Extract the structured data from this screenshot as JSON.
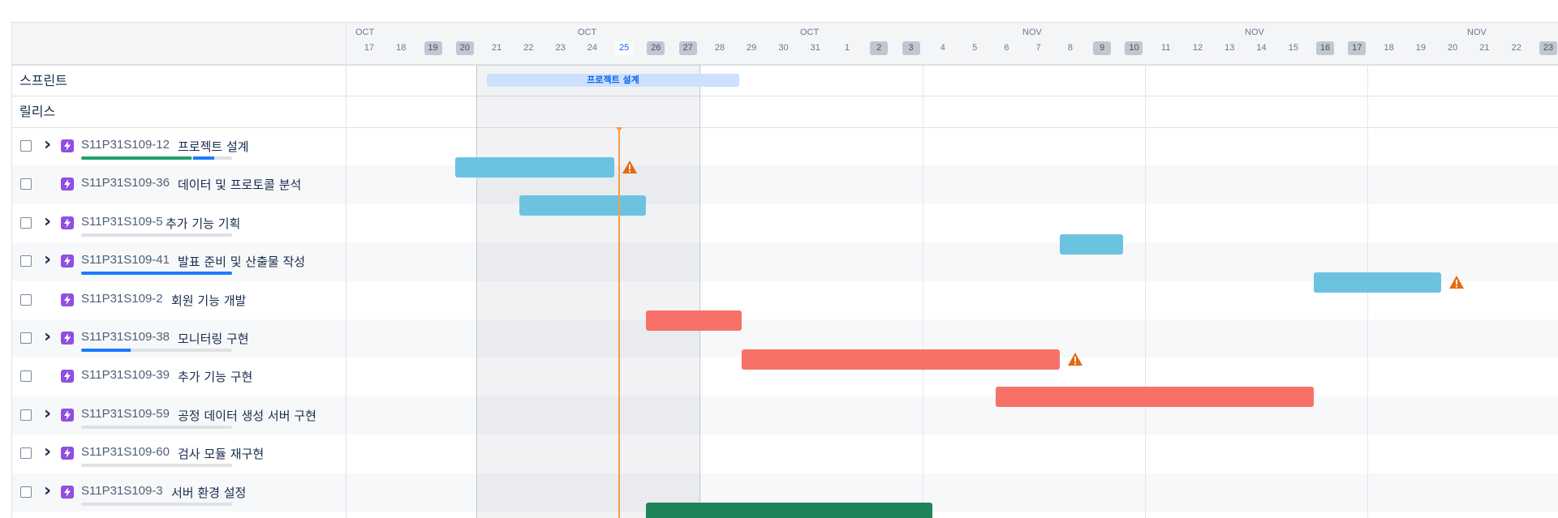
{
  "header": {
    "months": [
      "OCT",
      "OCT",
      "OCT",
      "NOV",
      "NOV",
      "NOV"
    ],
    "days": [
      "17",
      "18",
      "19",
      "20",
      "21",
      "22",
      "23",
      "24",
      "25",
      "26",
      "27",
      "28",
      "29",
      "30",
      "31",
      "1",
      "2",
      "3",
      "4",
      "5",
      "6",
      "7",
      "8",
      "9",
      "10",
      "11",
      "12",
      "13",
      "14",
      "15",
      "16",
      "17",
      "18",
      "19",
      "20",
      "21",
      "22",
      "23"
    ],
    "weekend_days": [
      "19",
      "20",
      "26",
      "27",
      "2",
      "3",
      "9",
      "10",
      "16",
      "17",
      "23"
    ],
    "today": "25"
  },
  "sections": {
    "sprint_label": "스프린트",
    "release_label": "릴리스",
    "sprint_pill": "프로젝트 설계"
  },
  "rows": [
    {
      "key": "S11P31S109-12",
      "title": "프로젝트 설계",
      "expandable": true,
      "progress": {
        "done": 0.73,
        "in_progress": 0.14
      },
      "bar_color": "blue",
      "warning": true
    },
    {
      "key": "S11P31S109-36",
      "title": "데이터 및 프로토콜 분석",
      "expandable": false,
      "progress": null,
      "bar_color": "blue",
      "warning": false
    },
    {
      "key": "S11P31S109-5",
      "title": "추가 기능 기획",
      "expandable": true,
      "progress": {
        "done": 0,
        "in_progress": 0
      },
      "bar_color": "blue",
      "warning": false
    },
    {
      "key": "S11P31S109-41",
      "title": "발표 준비 및 산출물 작성",
      "expandable": true,
      "progress": {
        "done": 0,
        "in_progress": 1.0
      },
      "bar_color": "blue",
      "warning": true
    },
    {
      "key": "S11P31S109-2",
      "title": "회원 기능 개발",
      "expandable": false,
      "progress": null,
      "bar_color": "red",
      "warning": false
    },
    {
      "key": "S11P31S109-38",
      "title": "모니터링 구현",
      "expandable": true,
      "progress": {
        "done": 0,
        "in_progress": 0.33
      },
      "bar_color": "red",
      "warning": true
    },
    {
      "key": "S11P31S109-39",
      "title": "추가 기능 구현",
      "expandable": false,
      "progress": null,
      "bar_color": "red",
      "warning": false
    },
    {
      "key": "S11P31S109-59",
      "title": "공정 데이터 생성 서버 구현",
      "expandable": true,
      "progress": {
        "done": 0,
        "in_progress": 0
      },
      "bar_color": null,
      "warning": false
    },
    {
      "key": "S11P31S109-60",
      "title": "검사 모듈 재구현",
      "expandable": true,
      "progress": {
        "done": 0,
        "in_progress": 0
      },
      "bar_color": null,
      "warning": false
    },
    {
      "key": "S11P31S109-3",
      "title": "서버 환경 설정",
      "expandable": true,
      "progress": {
        "done": 0,
        "in_progress": 0
      },
      "bar_color": "green",
      "warning": false
    }
  ],
  "colors": {
    "done": "#22a06b",
    "in_progress": "#1d7afc",
    "warning": "#e56910",
    "today_line": "#f99c4a"
  }
}
